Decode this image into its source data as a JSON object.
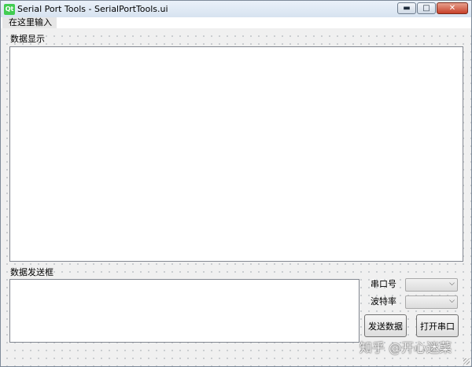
{
  "window": {
    "title": "Serial Port Tools - SerialPortTools.ui",
    "app_logo": "Qt",
    "controls": {
      "minimize": "▬",
      "maximize": "□",
      "close": "✕"
    }
  },
  "menubar": {
    "items": [
      {
        "label": "在这里输入"
      }
    ]
  },
  "form": {
    "display_label": "数据显示",
    "send_label": "数据发送框",
    "port_label": "串口号",
    "baud_label": "波特率",
    "port_value": "",
    "baud_value": "",
    "send_button": "发送数据",
    "open_button": "打开串口"
  },
  "watermark": "知乎 @开心迷菜",
  "icons": {
    "dropdown": "chevron-down-icon",
    "logo": "qt-logo-icon"
  }
}
